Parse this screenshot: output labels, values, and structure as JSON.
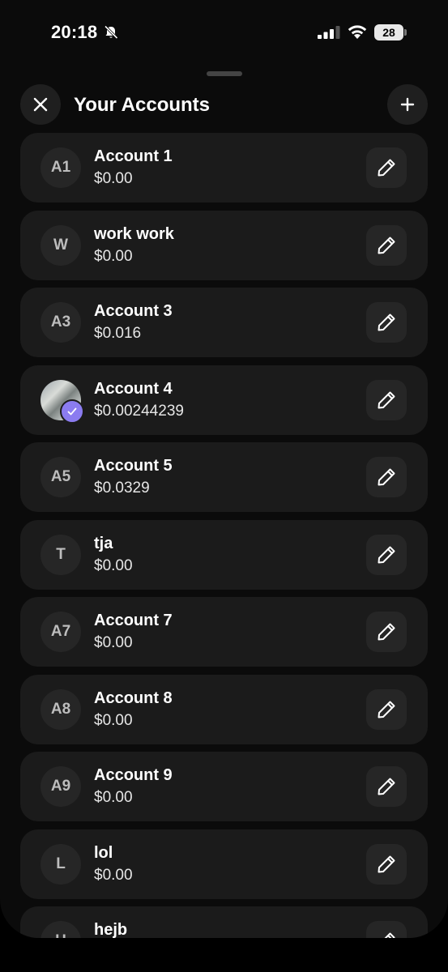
{
  "status_bar": {
    "time": "20:18",
    "battery": "28"
  },
  "header": {
    "title": "Your Accounts"
  },
  "accounts": [
    {
      "initials": "A1",
      "name": "Account 1",
      "balance": "$0.00"
    },
    {
      "initials": "W",
      "name": "work work",
      "balance": "$0.00"
    },
    {
      "initials": "A3",
      "name": "Account 3",
      "balance": "$0.016"
    },
    {
      "initials": "",
      "name": "Account 4",
      "balance": "$0.00244239",
      "selected": true
    },
    {
      "initials": "A5",
      "name": "Account 5",
      "balance": "$0.0329"
    },
    {
      "initials": "T",
      "name": "tja",
      "balance": "$0.00"
    },
    {
      "initials": "A7",
      "name": "Account 7",
      "balance": "$0.00"
    },
    {
      "initials": "A8",
      "name": "Account 8",
      "balance": "$0.00"
    },
    {
      "initials": "A9",
      "name": "Account 9",
      "balance": "$0.00"
    },
    {
      "initials": "L",
      "name": "lol",
      "balance": "$0.00"
    },
    {
      "initials": "H",
      "name": "hejb",
      "balance": ""
    }
  ],
  "colors": {
    "accent": "#8b7cf0",
    "card": "#1b1b1b",
    "background": "#0b0b0b"
  }
}
